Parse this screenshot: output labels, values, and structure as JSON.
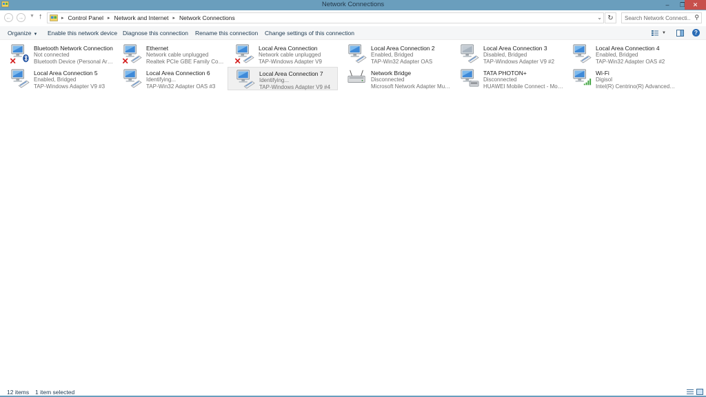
{
  "window": {
    "title": "Network Connections",
    "minimize_glyph": "–",
    "maximize_glyph": "❐",
    "close_glyph": "✕"
  },
  "address": {
    "crumbs": [
      "Control Panel",
      "Network and Internet",
      "Network Connections"
    ],
    "search_placeholder": "Search Network Connecti..."
  },
  "toolbar": {
    "organize": "Organize",
    "enable": "Enable this network device",
    "diagnose": "Diagnose this connection",
    "rename": "Rename this connection",
    "change": "Change settings of this connection",
    "help": "?"
  },
  "connections": [
    {
      "name": "Bluetooth Network Connection",
      "status": "Not connected",
      "device": "Bluetooth Device (Personal Area ...",
      "icon": "bluetooth-adapter-icon",
      "badge": "x"
    },
    {
      "name": "Ethernet",
      "status": "Network cable unplugged",
      "device": "Realtek PCIe GBE Family Controller",
      "icon": "ethernet-adapter-icon",
      "badge": "x"
    },
    {
      "name": "Local Area Connection",
      "status": "Network cable unplugged",
      "device": "TAP-Windows Adapter V9",
      "icon": "ethernet-adapter-icon",
      "badge": "x"
    },
    {
      "name": "Local Area Connection 2",
      "status": "Enabled, Bridged",
      "device": "TAP-Win32 Adapter OAS",
      "icon": "ethernet-adapter-icon",
      "badge": ""
    },
    {
      "name": "Local Area Connection 3",
      "status": "Disabled, Bridged",
      "device": "TAP-Windows Adapter V9 #2",
      "icon": "ethernet-adapter-disabled-icon",
      "badge": ""
    },
    {
      "name": "Local Area Connection 4",
      "status": "Enabled, Bridged",
      "device": "TAP-Win32 Adapter OAS #2",
      "icon": "ethernet-adapter-icon",
      "badge": ""
    },
    {
      "name": "Local Area Connection 5",
      "status": "Enabled, Bridged",
      "device": "TAP-Windows Adapter V9 #3",
      "icon": "ethernet-adapter-icon",
      "badge": ""
    },
    {
      "name": "Local Area Connection 6",
      "status": "Identifying...",
      "device": "TAP-Win32 Adapter OAS #3",
      "icon": "ethernet-adapter-icon",
      "badge": ""
    },
    {
      "name": "Local Area Connection 7",
      "status": "Identifying...",
      "device": "TAP-Windows Adapter V9 #4",
      "icon": "ethernet-adapter-icon",
      "badge": "",
      "selected": true
    },
    {
      "name": "Network Bridge",
      "status": "Disconnected",
      "device": "Microsoft Network Adapter Multi...",
      "icon": "network-bridge-icon",
      "badge": ""
    },
    {
      "name": "TATA PHOTON+",
      "status": "Disconnected",
      "device": "HUAWEI Mobile Connect - Modem",
      "icon": "modem-adapter-icon",
      "badge": ""
    },
    {
      "name": "Wi-Fi",
      "status": "Digisol",
      "device": "Intel(R) Centrino(R) Advanced-N ...",
      "icon": "wifi-adapter-icon",
      "badge": ""
    }
  ],
  "status": {
    "count": "12 items",
    "selection": "1 item selected"
  },
  "colors": {
    "titlebar": "#6a9ebd",
    "close": "#c7504c",
    "link_text": "#1e3a52",
    "status_x": "#d42020"
  }
}
